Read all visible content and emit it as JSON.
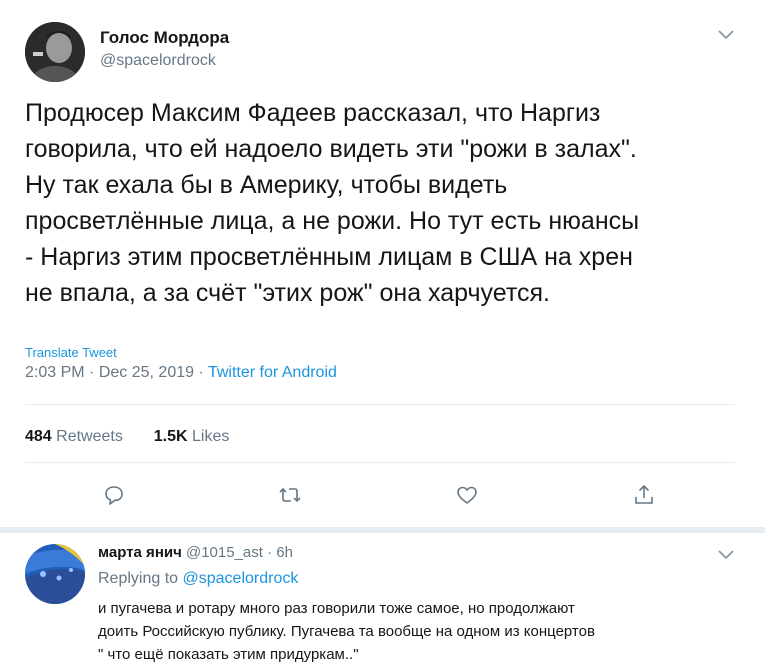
{
  "tweet": {
    "author_name": "Голос Мордора",
    "author_handle": "@spacelordrock",
    "lines": [
      "Продюсер Максим Фадеев рассказал, что Наргиз",
      "говорила, что ей надоело видеть эти \"рожи в залах\".",
      "Ну так ехала бы в Америку, чтобы видеть",
      "просветлённые лица, а не рожи. Но тут есть нюансы",
      "- Наргиз этим просветлённым лицам в США на хрен",
      "не впала, а за счёт \"этих рож\" она харчуется."
    ],
    "translate_label": "Translate Tweet",
    "time": "2:03 PM",
    "date": "Dec 25, 2019",
    "separator": "·",
    "source": "Twitter for Android",
    "retweets_count": "484",
    "retweets_label": "Retweets",
    "likes_count": "1.5K",
    "likes_label": "Likes",
    "icons": [
      "reply-icon",
      "retweet-icon",
      "like-icon",
      "share-icon",
      "chevron-down-icon"
    ]
  },
  "reply": {
    "author_name": "марта янич",
    "author_handle": "@1015_ast",
    "separator": "·",
    "age": "6h",
    "replying_prefix": "Replying to",
    "replying_to": "@spacelordrock",
    "lines": [
      "и пугачева и ротару много раз говорили тоже самое, но продолжают",
      "доить Российскую публику. Пугачева та вообще на одном из концертов",
      "\" что ещё показать этим придуркам..\""
    ]
  },
  "colors": {
    "text": "#14171a",
    "muted": "#657786",
    "link": "#1b95e0",
    "divider": "#e6ecf0"
  }
}
